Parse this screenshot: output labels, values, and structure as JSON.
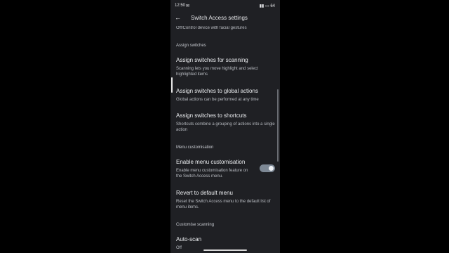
{
  "status": {
    "time": "12:50",
    "notification_icon": "message-icon",
    "right_text": "64"
  },
  "header": {
    "title": "Switch Access settings"
  },
  "partial_item": {
    "subtitle": "Off/Control device with facial gestures"
  },
  "sections": [
    {
      "header": "Assign switches",
      "items": [
        {
          "title": "Assign switches for scanning",
          "subtitle": "Scanning lets you move highlight and select highlighted items"
        },
        {
          "title": "Assign switches to global actions",
          "subtitle": "Global actions can be performed at any time"
        },
        {
          "title": "Assign switches to shortcuts",
          "subtitle": "Shortcuts combine a grouping of actions into a single action"
        }
      ]
    },
    {
      "header": "Menu customisation",
      "items": [
        {
          "title": "Enable menu customisation",
          "subtitle": "Enable menu customisation feature on the Switch Access menu.",
          "toggle_on": true
        },
        {
          "title": "Revert to default menu",
          "subtitle": "Reset the Switch Access menu to the default list of menu items."
        }
      ]
    },
    {
      "header": "Customise scanning",
      "items": [
        {
          "title": "Auto-scan",
          "subtitle": "Off"
        }
      ]
    }
  ],
  "colors": {
    "background": "#1f2024",
    "toggle_track": "#7d8895"
  }
}
